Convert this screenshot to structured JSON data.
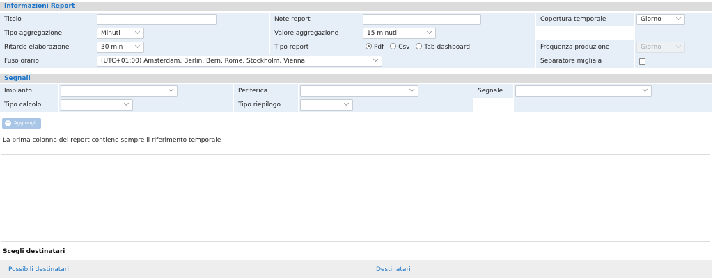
{
  "report_info": {
    "header": "Informazioni Report",
    "titolo_label": "Titolo",
    "titolo_value": "",
    "note_label": "Note report",
    "note_value": "",
    "copertura_label": "Copertura temporale",
    "copertura_value": "Giorno",
    "tipo_aggregazione_label": "Tipo aggregazione",
    "tipo_aggregazione_value": "Minuti",
    "valore_aggregazione_label": "Valore aggregazione",
    "valore_aggregazione_value": "15 minuti",
    "ritardo_label": "Ritardo elaborazione",
    "ritardo_value": "30 min",
    "tipo_report_label": "Tipo report",
    "tipo_report_options": [
      "Pdf",
      "Csv",
      "Tab dashboard"
    ],
    "tipo_report_selected": "Pdf",
    "frequenza_label": "Frequenza produzione",
    "frequenza_value": "Giorno",
    "fuso_label": "Fuso orario",
    "fuso_value": "(UTC+01:00) Amsterdam, Berlin, Bern, Rome, Stockholm, Vienna",
    "separatore_label": "Separatore migliaia",
    "separatore_checked": false
  },
  "segnali": {
    "header": "Segnali",
    "impianto_label": "Impianto",
    "periferica_label": "Periferica",
    "segnale_label": "Segnale",
    "tipo_calcolo_label": "Tipo calcolo",
    "tipo_riepilogo_label": "Tipo riepilogo",
    "add_button": "Aggiungi"
  },
  "note_text": "La prima colonna del report contiene sempre il riferimento temporale",
  "recipients": {
    "title": "Scegli destinatari",
    "possible_label": "Possibili destinatari",
    "selected_label": "Destinatari"
  },
  "colors": {
    "accent": "#1a73c8",
    "row_bg": "#e6eef8",
    "header_bg": "#dcdcdc"
  }
}
